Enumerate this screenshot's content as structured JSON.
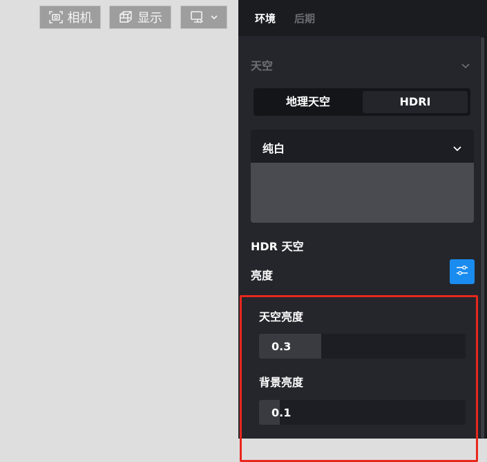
{
  "viewport_toolbar": {
    "camera_label": "相机",
    "display_label": "显示",
    "camera_icon": "camera-focus-icon",
    "display_icon": "cube-icon",
    "view_icon": "screen-switch-icon"
  },
  "tabs": [
    {
      "label": "环境",
      "active": true
    },
    {
      "label": "后期",
      "active": false
    }
  ],
  "sky_section": {
    "title": "天空",
    "mode_options": [
      {
        "label": "地理天空",
        "selected": false
      },
      {
        "label": "HDRI",
        "selected": true
      }
    ],
    "preset_select": {
      "value": "纯白"
    },
    "hdr_label": "HDR 天空",
    "brightness_label": "亮度",
    "sky_brightness": {
      "label": "天空亮度",
      "value": "0.3",
      "fill_fraction": 0.3
    },
    "background_brightness": {
      "label": "背景亮度",
      "value": "0.1",
      "fill_fraction": 0.1
    }
  },
  "colors": {
    "accent": "#1a8cf0",
    "highlight_border": "#e8271c",
    "panel_bg": "#25262c",
    "viewport_bg": "#dedede"
  }
}
